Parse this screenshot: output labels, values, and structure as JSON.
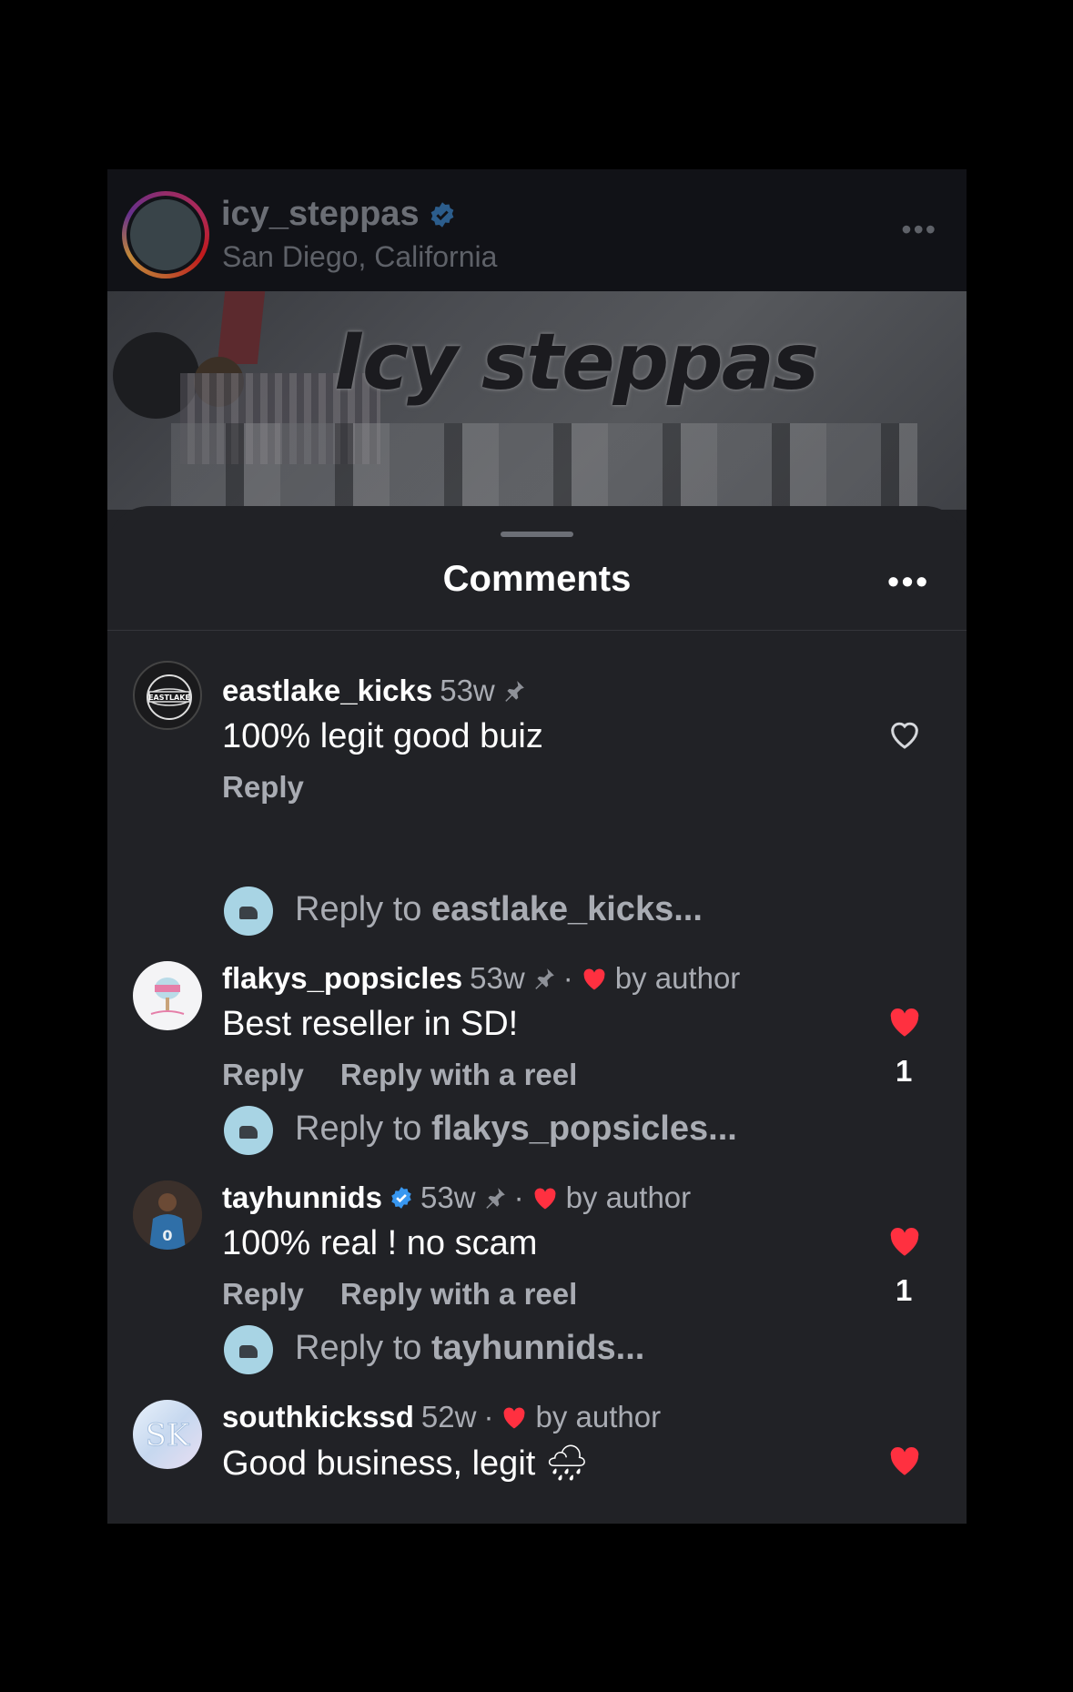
{
  "post": {
    "username": "icy_steppas",
    "location": "San Diego, California",
    "banner_text": "Icy steppas",
    "more_icon": "•••"
  },
  "sheet": {
    "title": "Comments",
    "more_icon": "•••"
  },
  "comments": [
    {
      "username": "eastlake_kicks",
      "time": "53w",
      "pinned": true,
      "liked_by_author": false,
      "text": "100% legit good buiz",
      "reply_label": "Reply",
      "reel_label": "",
      "liked": false,
      "like_count": "",
      "reply_prompt_prefix": "Reply to ",
      "reply_prompt_user": "eastlake_kicks..."
    },
    {
      "username": "flakys_popsicles",
      "time": "53w",
      "pinned": true,
      "liked_by_author": true,
      "by_author_label": "by author",
      "text": "Best reseller in SD!",
      "reply_label": "Reply",
      "reel_label": "Reply with a reel",
      "liked": true,
      "like_count": "1",
      "reply_prompt_prefix": "Reply to ",
      "reply_prompt_user": "flakys_popsicles..."
    },
    {
      "username": "tayhunnids",
      "verified": true,
      "time": "53w",
      "pinned": true,
      "liked_by_author": true,
      "by_author_label": "by author",
      "text": "100% real ! no scam",
      "reply_label": "Reply",
      "reel_label": "Reply with a reel",
      "liked": true,
      "like_count": "1",
      "reply_prompt_prefix": "Reply to ",
      "reply_prompt_user": "tayhunnids..."
    },
    {
      "username": "southkickssd",
      "time": "52w",
      "pinned": false,
      "liked_by_author": true,
      "by_author_label": "by author",
      "text": "Good business, legit 🌧",
      "liked": true
    }
  ],
  "colors": {
    "background": "#212226",
    "header": "#111217",
    "accent_heart": "#ff3040",
    "verified": "#3897f0",
    "muted_text": "#a9acb3"
  }
}
